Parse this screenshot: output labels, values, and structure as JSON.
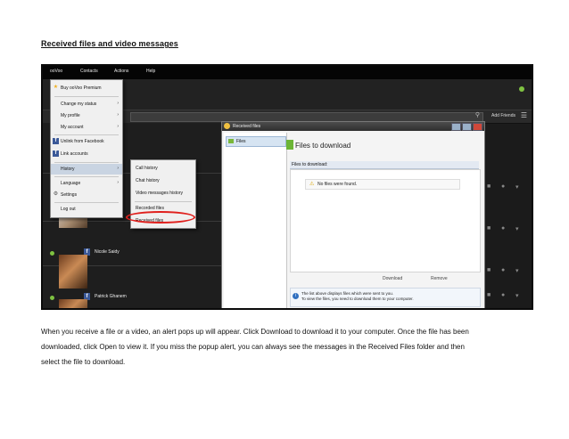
{
  "heading": "Received files and video messages",
  "screenshot": {
    "menubar": [
      "ooVoo",
      "Contacts",
      "Actions",
      "Help"
    ],
    "dropdown": {
      "items": [
        {
          "label": "Buy ooVoo Premium",
          "icon": "star-icon",
          "arrow": ""
        },
        {
          "label": "Change my status",
          "icon": "",
          "arrow": "›"
        },
        {
          "label": "My profile",
          "icon": "",
          "arrow": "›"
        },
        {
          "label": "My account",
          "icon": "",
          "arrow": "›"
        },
        {
          "label": "Unlink from Facebook",
          "icon": "facebook-icon",
          "arrow": ""
        },
        {
          "label": "Link accounts",
          "icon": "facebook-icon",
          "arrow": ""
        },
        {
          "label": "History",
          "icon": "",
          "arrow": "›"
        },
        {
          "label": "Language",
          "icon": "",
          "arrow": "›"
        },
        {
          "label": "Settings",
          "icon": "gear-icon",
          "arrow": ""
        },
        {
          "label": "Log out",
          "icon": "",
          "arrow": ""
        }
      ]
    },
    "submenu": {
      "items": [
        "Call history",
        "Chat history",
        "Video messages history",
        "Recorded files",
        "Received files"
      ]
    },
    "toolbar": {
      "add_friends": "Add Friends"
    },
    "contacts": [
      "Nicole Saidy",
      "Patrick Ghanem"
    ],
    "window": {
      "title": "Received files",
      "left_item": "Files",
      "main_title": "Files to download",
      "subheader": "Files to download:",
      "empty_message": "No files were found.",
      "download_button": "Download",
      "remove_button": "Remove",
      "info_line1": "The list above displays files which were sent to you.",
      "info_line2": "To view the files, you need to download them to your computer."
    }
  },
  "paragraph": {
    "line1": "When you receive a file or a video, an alert pops up will appear. Click Download to download it to your computer. Once the file has been",
    "line2": "downloaded, click Open to view it. If you miss the popup alert, you can always see the messages in the Received Files folder and then",
    "line3": "select the file to download."
  },
  "colors": {
    "highlight_oval": "#e0201d",
    "status_green": "#7fc241",
    "facebook": "#3b5998"
  }
}
